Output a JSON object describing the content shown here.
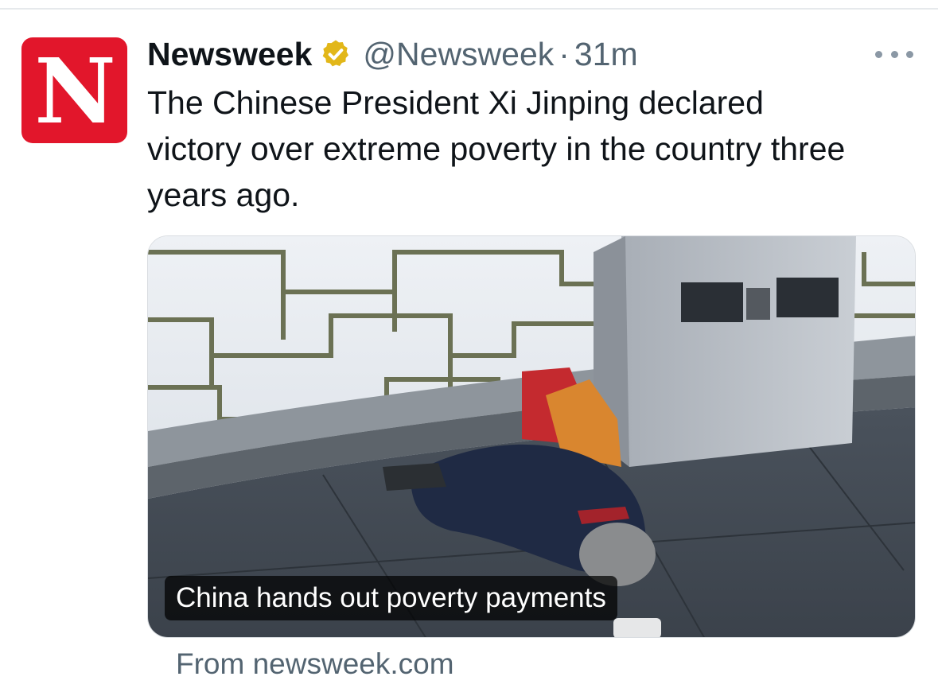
{
  "account": {
    "avatar_letter": "N",
    "avatar_color": "#e2162b",
    "display_name": "Newsweek",
    "verified_badge": "gold-verified-badge-icon",
    "handle": "@Newsweek",
    "separator": "·",
    "timestamp": "31m"
  },
  "tweet": {
    "text": "The Chinese President Xi Jinping declared victory over extreme poverty in the country three years ago."
  },
  "card": {
    "image_icon": "news-photo",
    "headline": "China hands out poverty payments",
    "source": "From newsweek.com"
  },
  "icons": {
    "more": "more-options-icon"
  },
  "colors": {
    "text_primary": "#0f1419",
    "text_secondary": "#536471",
    "verified_gold": "#e2b719"
  }
}
